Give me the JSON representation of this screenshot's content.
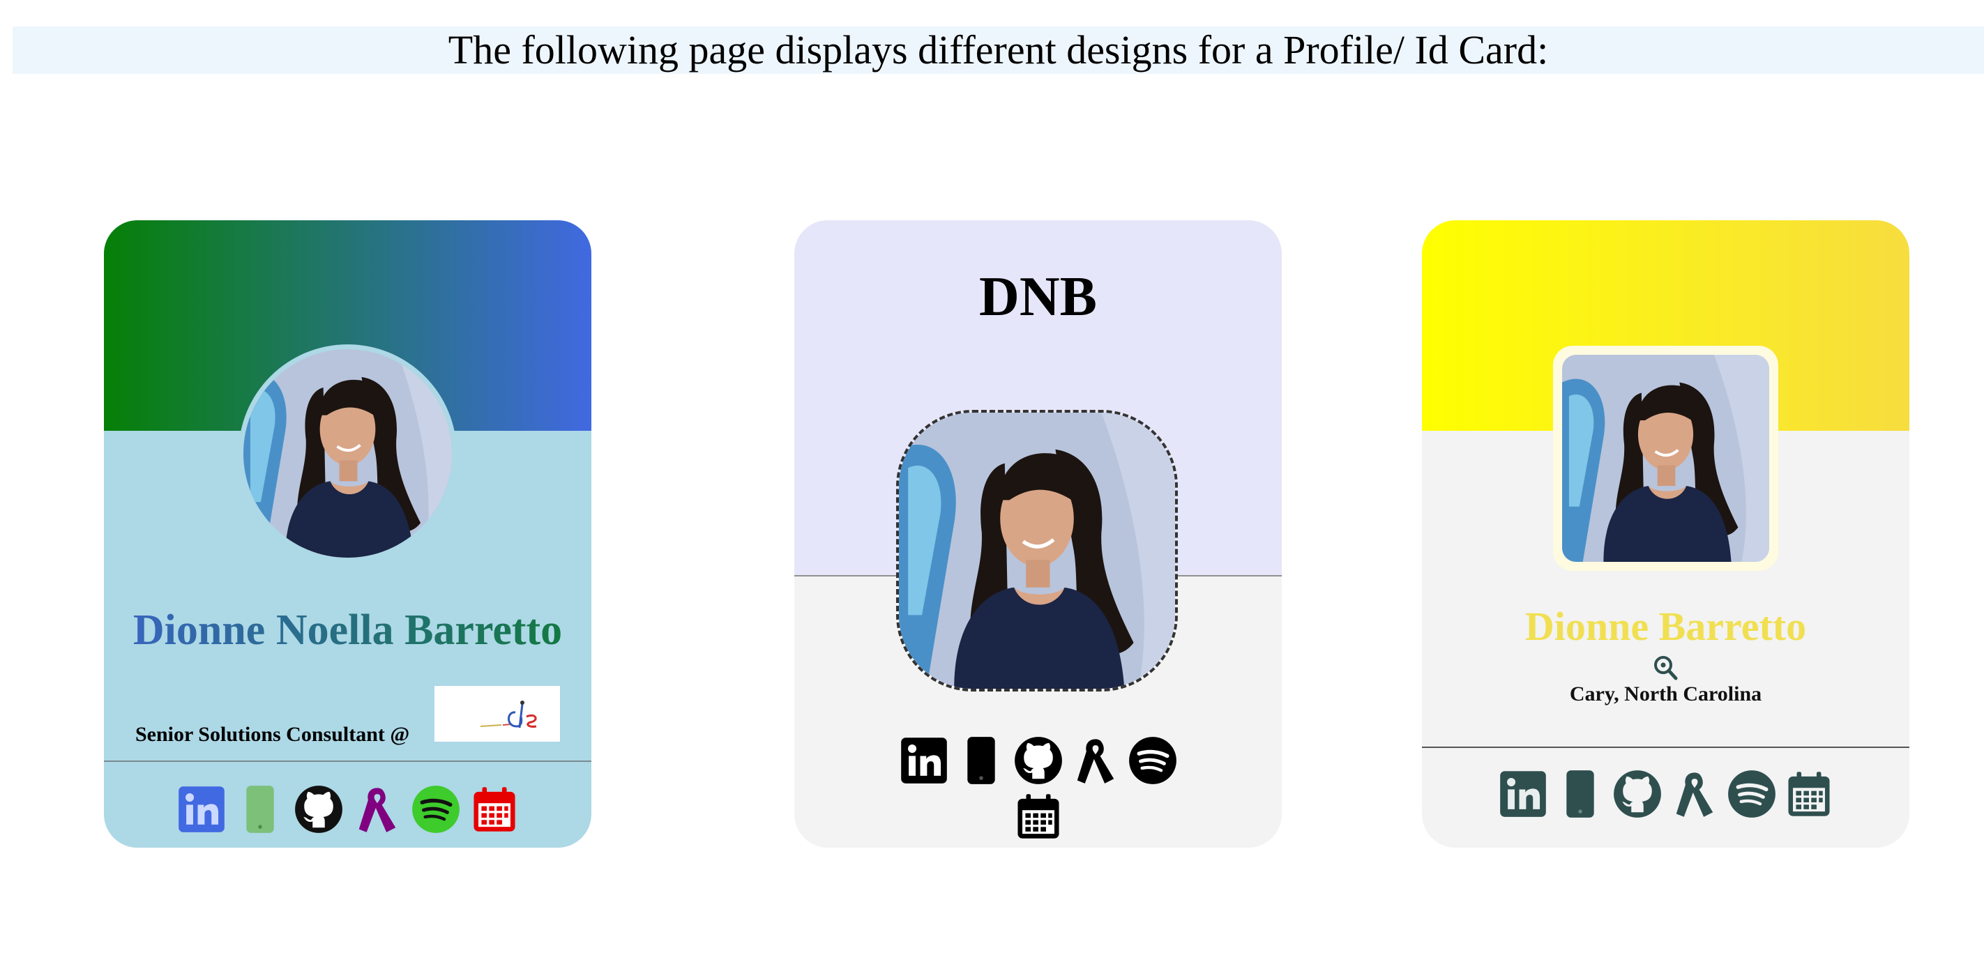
{
  "page": {
    "title": "The following page displays different designs for a Profile/ Id Card:"
  },
  "card1": {
    "name": "Dionne Noella Barretto",
    "role": "Senior Solutions Consultant @",
    "icon_color_linkedin": "#4169e1",
    "icon_color_phone": "#7cc07a",
    "icon_color_github": "#111111",
    "icon_color_ribbon": "#800080",
    "icon_color_spotify": "#1ed760",
    "icon_color_calendar": "#e60000",
    "icons": [
      "linkedin-icon",
      "phone-icon",
      "github-icon",
      "ribbon-icon",
      "spotify-icon",
      "calendar-icon"
    ]
  },
  "card2": {
    "monogram": "DNB",
    "icon_color": "#000000",
    "icons": [
      "linkedin-icon",
      "phone-icon",
      "github-icon",
      "ribbon-icon",
      "spotify-icon",
      "calendar-icon"
    ]
  },
  "card3": {
    "name": "Dionne Barretto",
    "location": "Cary, North Carolina",
    "icon_color": "#2f4f4f",
    "icons": [
      "linkedin-icon",
      "phone-icon",
      "github-icon",
      "ribbon-icon",
      "spotify-icon",
      "calendar-icon"
    ]
  },
  "colors": {
    "card1_banner_start": "#068006",
    "card1_banner_end": "#4169e1",
    "card1_body": "#add8e6",
    "card2_top": "#e6e6fa",
    "card3_banner_start": "#ffff00",
    "card3_banner_end": "#f7dd3f",
    "card3_name": "#f1df52"
  }
}
